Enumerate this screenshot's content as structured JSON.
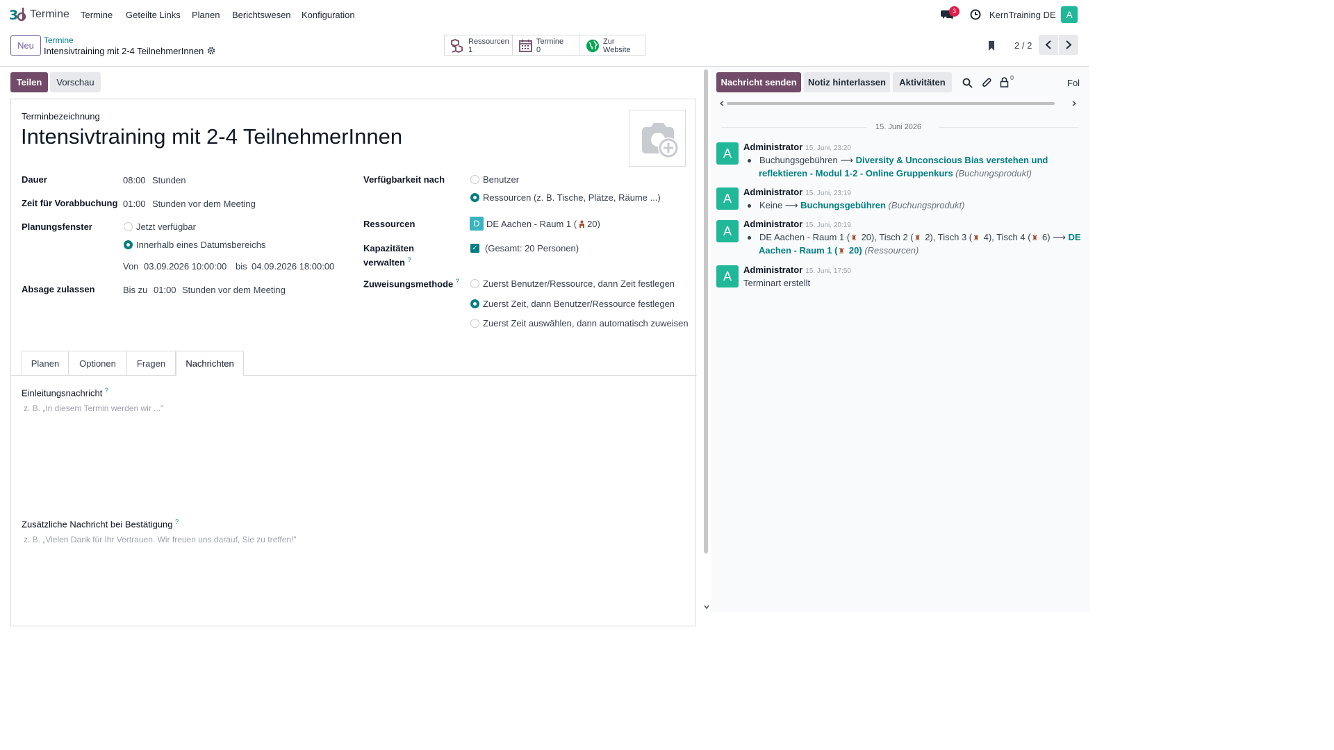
{
  "nav": {
    "app_name": "Termine",
    "menu": [
      "Termine",
      "Geteilte Links",
      "Planen",
      "Berichtswesen",
      "Konfiguration"
    ],
    "messages_badge": "3",
    "company": "KernTraining DE",
    "user_initial": "A"
  },
  "control": {
    "new_label": "Neu",
    "breadcrumb_parent": "Termine",
    "record_title": "Intensivtraining mit 2-4 TeilnehmerInnen",
    "smart_buttons": [
      {
        "line1": "Ressourcen",
        "line2": "1"
      },
      {
        "line1": "Termine",
        "line2": "0"
      },
      {
        "line1": "Zur",
        "line2": "Website"
      }
    ],
    "pager": "2 / 2"
  },
  "actions": {
    "share": "Teilen",
    "preview": "Vorschau"
  },
  "form": {
    "title_label": "Terminbezeichnung",
    "title": "Intensivtraining mit 2-4 TeilnehmerInnen",
    "duration_label": "Dauer",
    "duration_value": "08:00",
    "duration_unit": "Stunden",
    "prebook_label": "Zeit für Vorabbuchung",
    "prebook_value": "01:00",
    "prebook_unit": "Stunden vor dem Meeting",
    "planning_label": "Planungsfenster",
    "planning_opt1": "Jetzt verfügbar",
    "planning_opt2": "Innerhalb eines Datumsbereichs",
    "from_label": "Von",
    "from_value": "03.09.2026 10:00:00",
    "to_label": "bis",
    "to_value": "04.09.2026 18:00:00",
    "cancel_label": "Absage zulassen",
    "cancel_prefix": "Bis zu",
    "cancel_value": "01:00",
    "cancel_unit": "Stunden vor dem Meeting",
    "availability_label": "Verfügbarkeit nach",
    "availability_opt1": "Benutzer",
    "availability_opt2": "Ressourcen (z. B. Tische, Plätze, Räume ...)",
    "resources_label": "Ressourcen",
    "resource_initial": "D",
    "resource_name": "DE Aachen - Raum 1 (",
    "resource_capacity": "20)",
    "capacity_label_1": "Kapazitäten",
    "capacity_label_2": "verwalten",
    "capacity_value": "(Gesamt: 20 Personen)",
    "assign_label": "Zuweisungsmethode",
    "assign_opt1": "Zuerst Benutzer/Ressource, dann Zeit festlegen",
    "assign_opt2": "Zuerst Zeit, dann Benutzer/Ressource festlegen",
    "assign_opt3": "Zuerst Zeit auswählen, dann automatisch zuweisen",
    "help_mark": "?"
  },
  "tabs": [
    "Planen",
    "Optionen",
    "Fragen",
    "Nachrichten"
  ],
  "messages_tab": {
    "intro_label": "Einleitungsnachricht",
    "intro_placeholder": "z. B. „In diesem Termin werden wir ...\"",
    "confirm_label": "Zusätzliche Nachricht bei Bestätigung",
    "confirm_placeholder": "z. B. „Vielen Dank für Ihr Vertrauen. Wir freuen uns darauf, Sie zu treffen!\""
  },
  "chatter": {
    "send_message": "Nachricht senden",
    "log_note": "Notiz hinterlassen",
    "activities": "Aktivitäten",
    "followers_count": "0",
    "follow": "Fol",
    "date_separator": "15. Juni 2026",
    "messages": [
      {
        "author": "Administrator",
        "date": "15. Juni, 23:20",
        "initial": "A",
        "old": "Buchungsgebühren",
        "new_line1": "Diversity & Unconscious Bias verstehen und",
        "new_line2": "reflektieren - Modul 1-2 - Online Gruppenkurs",
        "field": "(Buchungsprodukt)"
      },
      {
        "author": "Administrator",
        "date": "15. Juni, 23:19",
        "initial": "A",
        "old": "Keine",
        "new_line1": "Buchungsgebühren",
        "field": "(Buchungsprodukt)"
      },
      {
        "author": "Administrator",
        "date": "15. Juni, 20:19",
        "initial": "A",
        "old_seg1": "DE Aachen - Raum 1 (",
        "old_seg2": "20), Tisch 2 (",
        "old_seg3": "2), Tisch 3 (",
        "old_seg4": "4), Tisch 4 (",
        "old_seg5": "6)",
        "new_line1": "DE",
        "new_line2a": "Aachen - Raum 1 (",
        "new_line2b": "20)",
        "field": "(Ressourcen)"
      },
      {
        "author": "Administrator",
        "date": "15. Juni, 17:50",
        "initial": "A",
        "body": "Terminart erstellt"
      }
    ]
  },
  "colors": {
    "primary": "#714b67",
    "accent": "#017e84",
    "avatar": "#21b799"
  }
}
